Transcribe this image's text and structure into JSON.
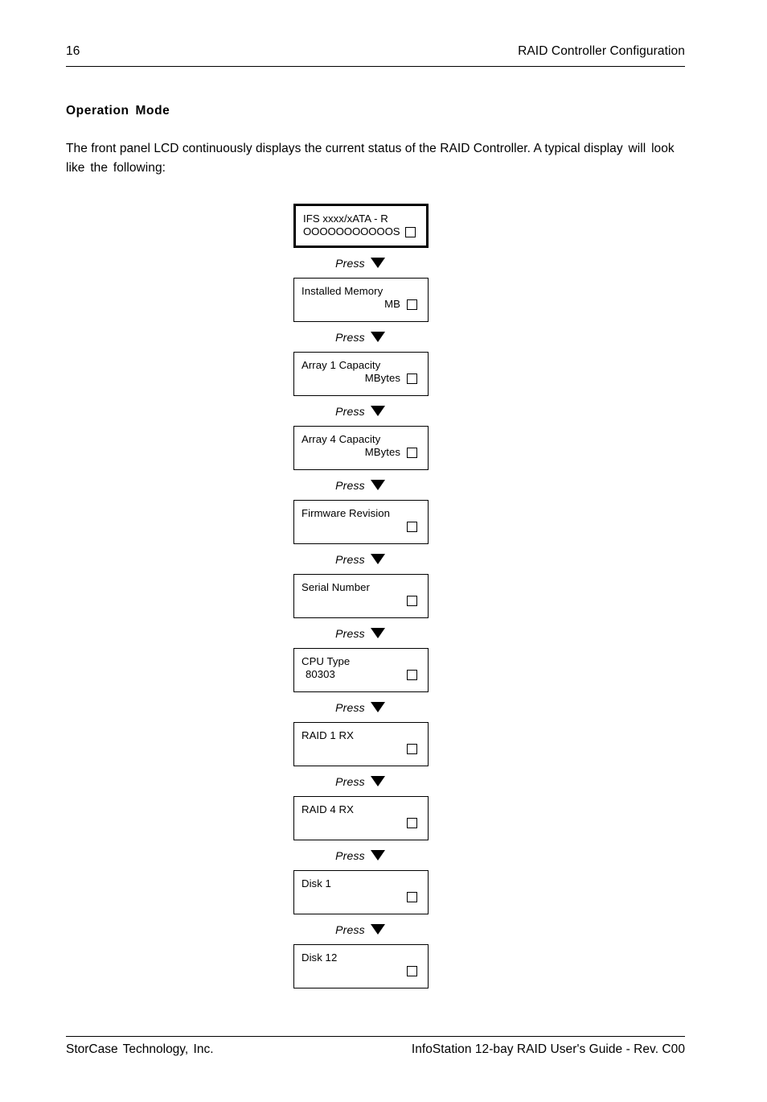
{
  "header": {
    "page_number": "16",
    "title": "RAID Controller Configuration"
  },
  "section": {
    "heading": "Operation  Mode",
    "intro_line1": "The front panel LCD continuously displays the current status of the RAID Controller.  A typical",
    "intro_line2": "display will look like the following:"
  },
  "press_label": "Press",
  "arrow_icon": "triangle-down-icon",
  "indicator_icon": "square-outline-icon",
  "lcd_screens": [
    {
      "id": "model-screen",
      "line1": "IFS xxxx/xATA - R",
      "line2": "OOOOOOOOOOOS",
      "line1_align": "left",
      "line2_align": "left",
      "emphasis": true
    },
    {
      "id": "installed-memory-screen",
      "line1": "Installed Memory",
      "line2": "MB",
      "line1_align": "left",
      "line2_align": "right",
      "emphasis": false
    },
    {
      "id": "array-1-capacity-screen",
      "line1": "Array 1 Capacity",
      "line2": "MBytes",
      "line1_align": "left",
      "line2_align": "right",
      "emphasis": false
    },
    {
      "id": "array-4-capacity-screen",
      "line1": "Array 4 Capacity",
      "line2": "MBytes",
      "line1_align": "left",
      "line2_align": "right",
      "emphasis": false
    },
    {
      "id": "firmware-revision-screen",
      "line1": "Firmware Revision",
      "line2": "",
      "line1_align": "left",
      "line2_align": "left",
      "emphasis": false
    },
    {
      "id": "serial-number-screen",
      "line1": "Serial Number",
      "line2": "",
      "line1_align": "left",
      "line2_align": "left",
      "emphasis": false
    },
    {
      "id": "cpu-type-screen",
      "line1": "CPU Type",
      "line2": "80303",
      "line1_align": "left",
      "line2_align": "indent",
      "emphasis": false
    },
    {
      "id": "raid-1-rx-screen",
      "line1": "RAID 1 RX",
      "line2": "",
      "line1_align": "left",
      "line2_align": "left",
      "emphasis": false
    },
    {
      "id": "raid-4-rx-screen",
      "line1": "RAID 4 RX",
      "line2": "",
      "line1_align": "left",
      "line2_align": "left",
      "emphasis": false
    },
    {
      "id": "disk-1-screen",
      "line1": "Disk 1",
      "line2": "",
      "line1_align": "left",
      "line2_align": "left",
      "emphasis": false
    },
    {
      "id": "disk-12-screen",
      "line1": "Disk 12",
      "line2": "",
      "line1_align": "left",
      "line2_align": "left",
      "emphasis": false
    }
  ],
  "footer": {
    "left": "StorCase Technology, Inc.",
    "right": "InfoStation 12-bay RAID User's Guide - Rev. C00"
  }
}
